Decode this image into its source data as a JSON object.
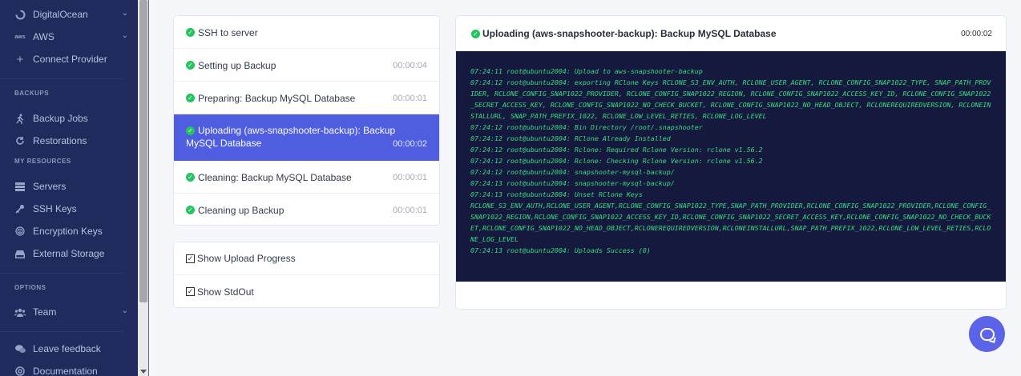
{
  "sidebar": {
    "providers": [
      {
        "label": "DigitalOcean",
        "icon": "digitalocean-icon",
        "chevron": "⌄"
      },
      {
        "label": "AWS",
        "icon": "aws-icon",
        "chevron": "⌄"
      },
      {
        "label": "Connect Provider",
        "icon": "plus-icon"
      }
    ],
    "backups_section": "BACKUPS",
    "backups": [
      {
        "label": "Backup Jobs",
        "icon": "runner-icon"
      },
      {
        "label": "Restorations",
        "icon": "restore-icon"
      }
    ],
    "resources_section": "MY RESOURCES",
    "resources": [
      {
        "label": "Servers",
        "icon": "servers-icon"
      },
      {
        "label": "SSH Keys",
        "icon": "key-icon"
      },
      {
        "label": "Encryption Keys",
        "icon": "fingerprint-icon"
      },
      {
        "label": "External Storage",
        "icon": "storage-icon"
      }
    ],
    "options_section": "OPTIONS",
    "team": {
      "label": "Team",
      "icon": "team-icon",
      "chevron": "⌄"
    },
    "footer": [
      {
        "label": "Leave feedback",
        "icon": "chat-icon"
      },
      {
        "label": "Documentation",
        "icon": "docs-icon"
      }
    ]
  },
  "steps": [
    {
      "label": "SSH to server",
      "time": ""
    },
    {
      "label": "Setting up Backup",
      "time": "00:00:04"
    },
    {
      "label": "Preparing: Backup MySQL Database",
      "time": "00:00:01"
    },
    {
      "label": "Uploading (aws-snapshooter-backup): Backup MySQL Database",
      "time": "00:00:02",
      "active": true
    },
    {
      "label": "Cleaning: Backup MySQL Database",
      "time": "00:00:01"
    },
    {
      "label": "Cleaning up Backup",
      "time": "00:00:01"
    }
  ],
  "options": [
    {
      "label": "Show Upload Progress",
      "checked": true
    },
    {
      "label": "Show StdOut",
      "checked": true
    }
  ],
  "log": {
    "title": "Uploading (aws-snapshooter-backup): Backup MySQL Database",
    "time": "00:00:02",
    "lines": [
      "07:24:11 root@ubuntu2004: Upload to aws-snapshooter-backup",
      "07:24:12 root@ubuntu2004: exporting RClone Keys RCLONE_S3_ENV_AUTH, RCLONE_USER_AGENT, RCLONE_CONFIG_SNAP1022_TYPE, SNAP_PATH_PROVIDER, RCLONE_CONFIG_SNAP1022_PROVIDER, RCLONE_CONFIG_SNAP1022_REGION, RCLONE_CONFIG_SNAP1022_ACCESS_KEY_ID, RCLONE_CONFIG_SNAP1022_SECRET_ACCESS_KEY, RCLONE_CONFIG_SNAP1022_NO_CHECK_BUCKET, RCLONE_CONFIG_SNAP1022_NO_HEAD_OBJECT, RCLONEREQUIREDVERSION, RCLONEINSTALLURL, SNAP_PATH_PREFIX_1022, RCLONE_LOW_LEVEL_RETIES, RCLONE_LOG_LEVEL",
      "07:24:12 root@ubuntu2004: Bin Directory /root/.snapshooter",
      "07:24:12 root@ubuntu2004: RClone Already Installed",
      "07:24:12 root@ubuntu2004: Rclone: Required Rclone Version: rclone v1.56.2",
      "07:24:12 root@ubuntu2004: Rclone: Checking Rclone Version: rclone v1.56.2",
      "07:24:12 root@ubuntu2004: snapshooter-mysql-backup/",
      "07:24:13 root@ubuntu2004: snapshooter-mysql-backup/",
      "07:24:13 root@ubuntu2004: Unset RClone Keys",
      "RCLONE_S3_ENV_AUTH,RCLONE_USER_AGENT,RCLONE_CONFIG_SNAP1022_TYPE,SNAP_PATH_PROVIDER,RCLONE_CONFIG_SNAP1022_PROVIDER,RCLONE_CONFIG_SNAP1022_REGION,RCLONE_CONFIG_SNAP1022_ACCESS_KEY_ID,RCLONE_CONFIG_SNAP1022_SECRET_ACCESS_KEY,RCLONE_CONFIG_SNAP1022_NO_CHECK_BUCKET,RCLONE_CONFIG_SNAP1022_NO_HEAD_OBJECT,RCLONEREQUIREDVERSION,RCLONEINSTALLURL,SNAP_PATH_PREFIX_1022,RCLONE_LOW_LEVEL_RETIES,RCLONE_LOG_LEVEL",
      "07:24:13 root@ubuntu2004: Uploads Success (0)"
    ]
  },
  "colors": {
    "sidebar_bg": "#1f2b5c",
    "accent": "#4f5de0",
    "success": "#22c55e",
    "terminal_bg": "#15193d",
    "terminal_text": "#3ddc84"
  },
  "help_icon": "chat-bubble-icon"
}
